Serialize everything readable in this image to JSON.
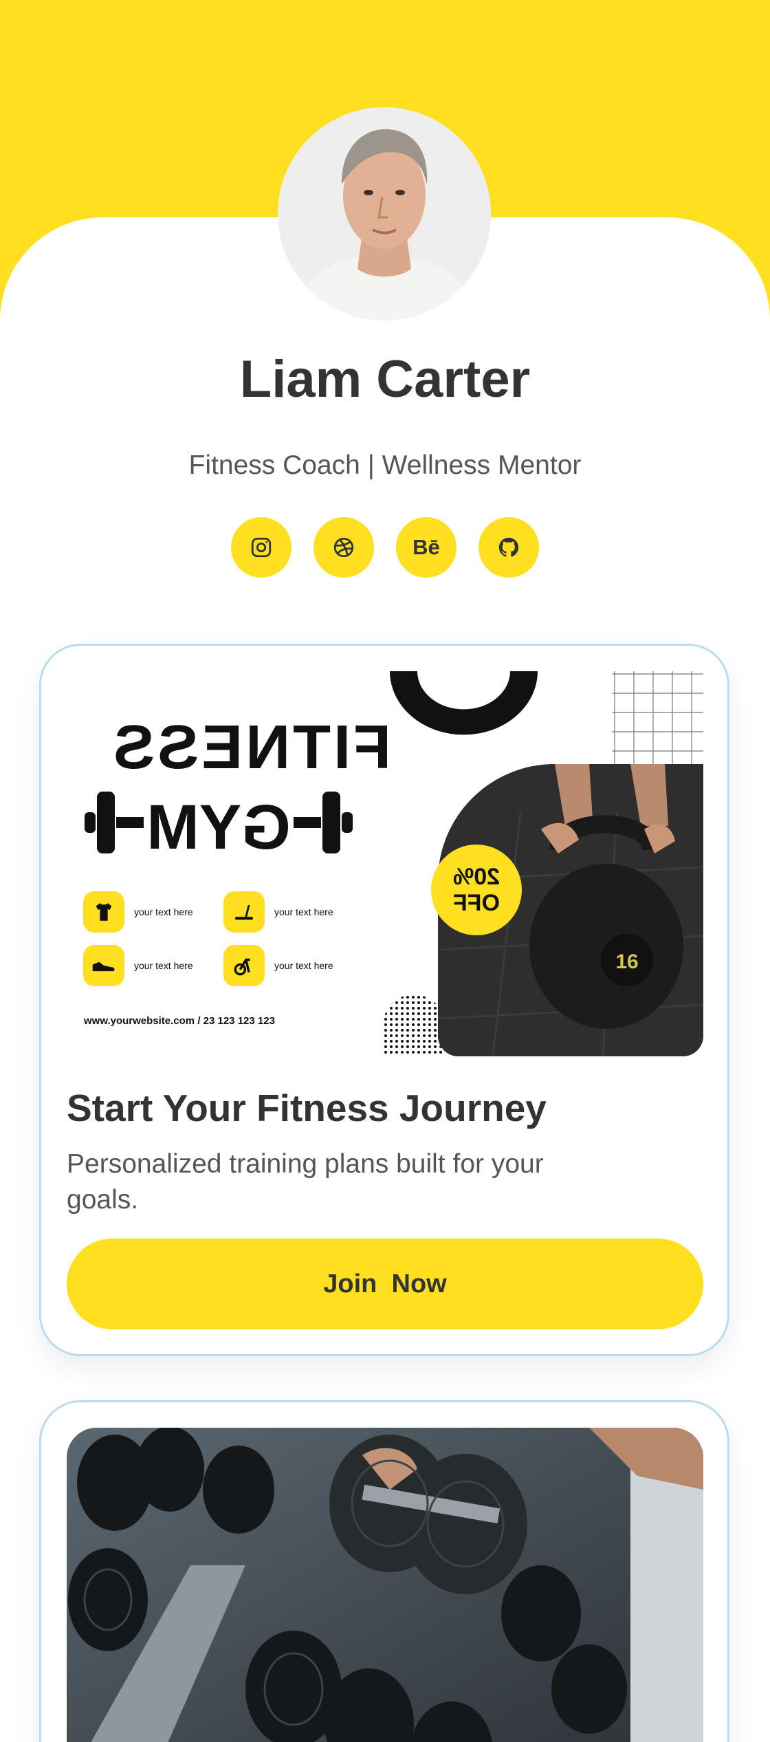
{
  "profile": {
    "name": "Liam Carter",
    "tagline": "Fitness Coach | Wellness Mentor"
  },
  "socials": [
    {
      "icon": "instagram-icon"
    },
    {
      "icon": "dribbble-icon"
    },
    {
      "icon": "behance-icon",
      "text": "Bē"
    },
    {
      "icon": "github-icon"
    }
  ],
  "colors": {
    "accent": "#FFE020",
    "text_dark": "#333333",
    "text_muted": "#555555",
    "card_border": "#BBDCEE"
  },
  "cards": [
    {
      "banner": {
        "word": "FITNESS",
        "gym": "GYM",
        "items": [
          "your text here",
          "your text here",
          "your text here",
          "your text here"
        ],
        "url": "www.yourwebsite.com / 23 123 123 123",
        "offer_percent": "20%",
        "offer_label": "OFF",
        "kettlebell_weight": "16"
      },
      "title": "Start Your Fitness Journey",
      "description": "Personalized training plans built for your goals.",
      "button_label": "Join  Now"
    },
    {
      "image": "dumbbell-rack-photo"
    }
  ]
}
